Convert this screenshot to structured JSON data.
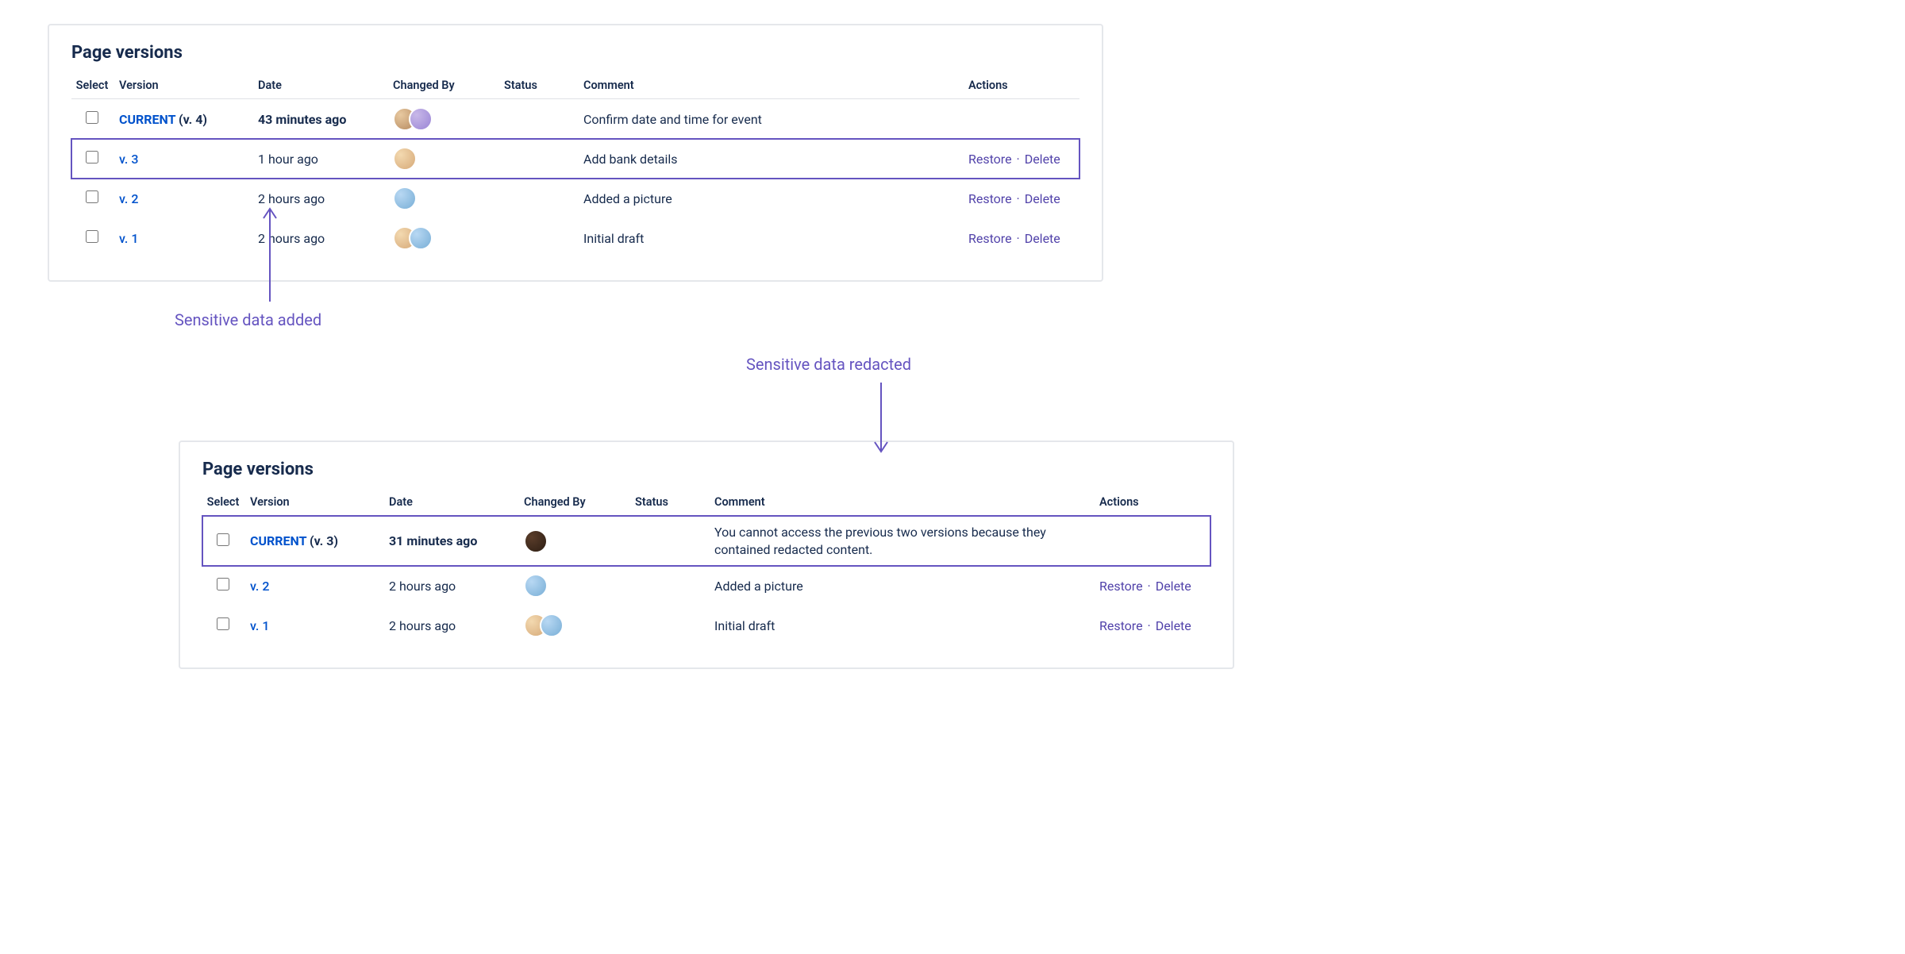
{
  "panel1": {
    "title": "Page versions",
    "headers": {
      "select": "Select",
      "version": "Version",
      "date": "Date",
      "changedBy": "Changed By",
      "status": "Status",
      "comment": "Comment",
      "actions": "Actions"
    },
    "rows": [
      {
        "currentLabel": "CURRENT",
        "currentSub": " (v. 4)",
        "date": "43 minutes ago",
        "comment": "Confirm date and time for event",
        "actions": {
          "restore": "",
          "delete": ""
        }
      },
      {
        "versionLink": "v. 3",
        "date": "1 hour ago",
        "comment": "Add bank details",
        "actions": {
          "restore": "Restore",
          "delete": "Delete"
        }
      },
      {
        "versionLink": "v. 2",
        "date": "2 hours ago",
        "comment": "Added a picture",
        "actions": {
          "restore": "Restore",
          "delete": "Delete"
        }
      },
      {
        "versionLink": "v. 1",
        "date": "2 hours ago",
        "comment": "Initial draft",
        "actions": {
          "restore": "Restore",
          "delete": "Delete"
        }
      }
    ]
  },
  "annotation1": "Sensitive data added",
  "annotation2": "Sensitive data redacted",
  "panel2": {
    "title": "Page versions",
    "headers": {
      "select": "Select",
      "version": "Version",
      "date": "Date",
      "changedBy": "Changed By",
      "status": "Status",
      "comment": "Comment",
      "actions": "Actions"
    },
    "rows": [
      {
        "currentLabel": "CURRENT",
        "currentSub": " (v. 3)",
        "date": "31 minutes ago",
        "comment": "You cannot access the previous two versions because they contained redacted content.",
        "actions": {
          "restore": "",
          "delete": ""
        }
      },
      {
        "versionLink": "v. 2",
        "date": "2 hours ago",
        "comment": "Added a picture",
        "actions": {
          "restore": "Restore",
          "delete": "Delete"
        }
      },
      {
        "versionLink": "v. 1",
        "date": "2 hours ago",
        "comment": "Initial draft",
        "actions": {
          "restore": "Restore",
          "delete": "Delete"
        }
      }
    ]
  },
  "actionSeparator": "·"
}
